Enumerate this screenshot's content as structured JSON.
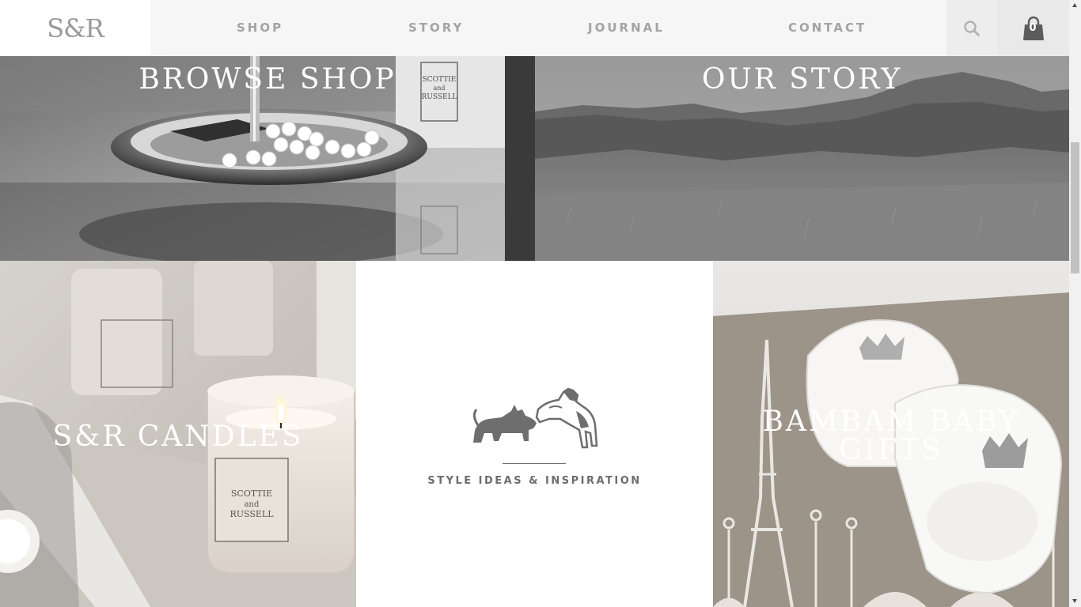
{
  "header": {
    "logo_text": "S&R",
    "nav": [
      "SHOP",
      "STORY",
      "JOURNAL",
      "CONTACT"
    ],
    "search_icon": "search-icon",
    "cart_icon": "shopping-bag-icon",
    "cart_count": "0"
  },
  "tiles": {
    "browse_shop": "BROWSE SHOP",
    "our_story": "OUR STORY",
    "candles": "S&R CANDLES",
    "baby_gifts_line1": "BAMBAM BABY",
    "baby_gifts_line2": "GIFTS"
  },
  "brand_panel": {
    "icon": "scottie-and-terrier-dogs-logo",
    "tagline": "STYLE IDEAS & INSPIRATION"
  },
  "product_labels": {
    "candle_jar": [
      "SCOTTIE",
      "and",
      "RUSSELL"
    ]
  },
  "colors": {
    "header_bg": "#f6f6f6",
    "nav_text": "#a3a3a3",
    "tile_text": "#ffffff",
    "tagline": "#6d6d6d"
  }
}
